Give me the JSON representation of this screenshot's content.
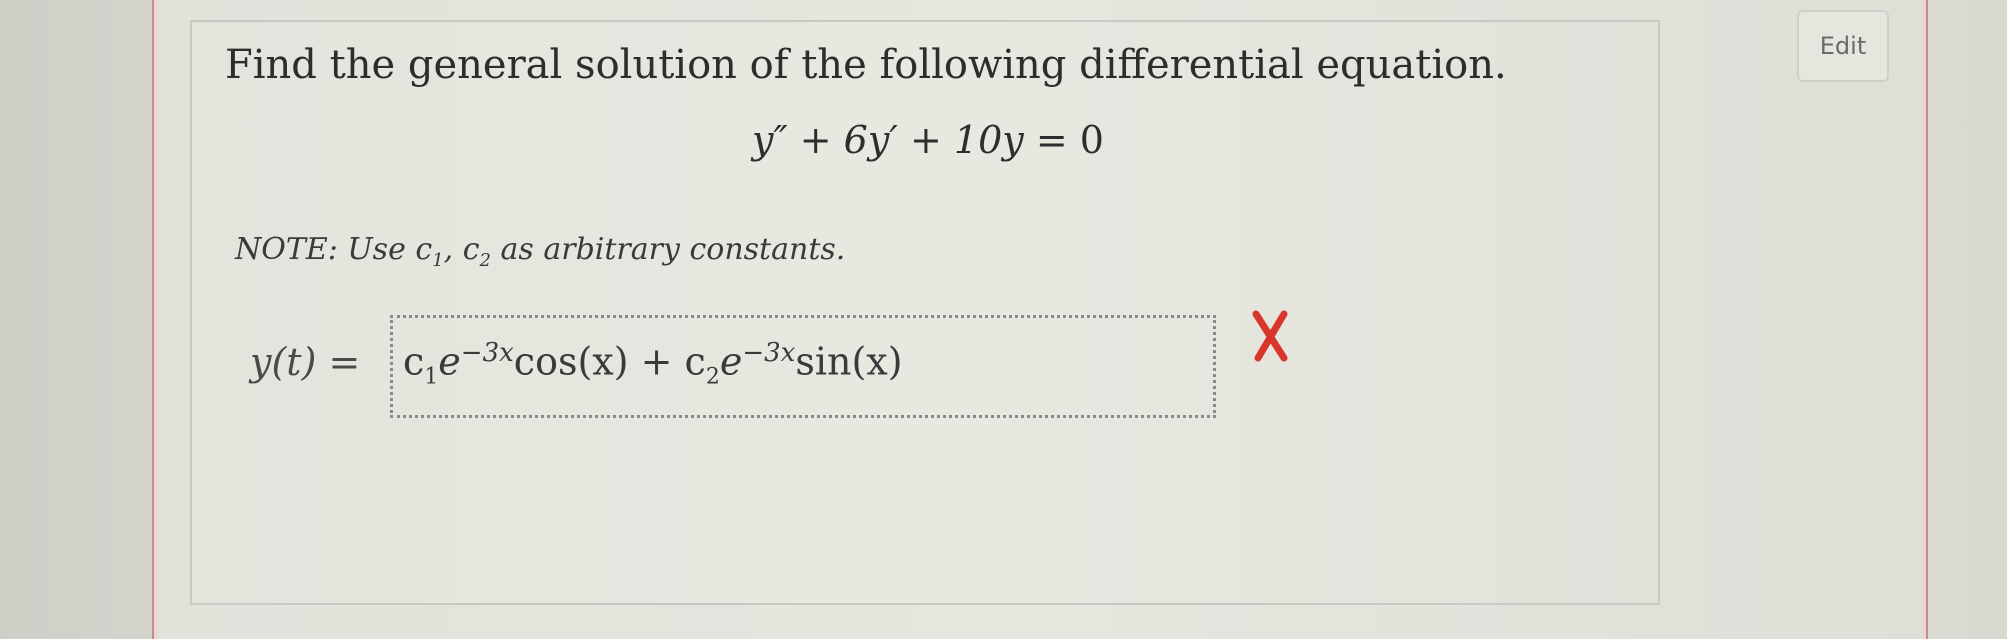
{
  "question": {
    "prompt": "Find the general solution of the following differential equation.",
    "equation_lhs": "y″ + 6y′ + 10y",
    "equation_eq": " = ",
    "equation_rhs": "0",
    "note_prefix": "NOTE: Use ",
    "note_c1": "c",
    "note_c1_sub": "1",
    "note_sep": ", ",
    "note_c2": "c",
    "note_c2_sub": "2",
    "note_suffix": " as arbitrary constants."
  },
  "answer": {
    "label": "y(t) =",
    "c1": "c",
    "c1_sub": "1",
    "e1": "e",
    "exp1": "−3x",
    "cos": "cos(x)",
    "plus": " + ",
    "c2": "c",
    "c2_sub": "2",
    "e2": "e",
    "exp2": "−3x",
    "sin": "sin(x)"
  },
  "status": {
    "icon": "incorrect-x-icon",
    "color": "#d9362b"
  },
  "toolbar": {
    "edit_label": "Edit"
  }
}
